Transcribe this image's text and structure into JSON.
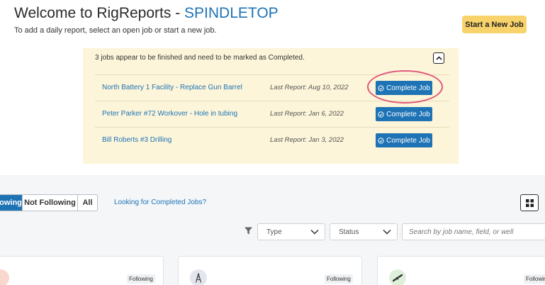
{
  "header": {
    "title_prefix": "Welcome to RigReports - ",
    "company": "SPINDLETOP",
    "subtitle": "To add a daily report, select an open job or start a new job.",
    "start_button": "Start a New Job"
  },
  "notice": {
    "message": "3 jobs appear to be finished and need to be marked as Completed.",
    "rows": [
      {
        "job": "North Battery 1 Facility - Replace Gun Barrel",
        "last_report": "Last Report: Aug 10, 2022",
        "button": "Complete Job"
      },
      {
        "job": "Peter Parker #72 Workover - Hole in tubing",
        "last_report": "Last Report: Jan 6, 2022",
        "button": "Complete Job"
      },
      {
        "job": "Bill Roberts #3 Drilling",
        "last_report": "Last Report: Jan 3, 2022",
        "button": "Complete Job"
      }
    ]
  },
  "filters": {
    "segments": [
      "owing",
      "Not Following",
      "All"
    ],
    "completed_link": "Looking for Completed Jobs?",
    "type_label": "Type",
    "status_label": "Status",
    "search_placeholder": "Search by job name, field, or well"
  },
  "cards": [
    {
      "badge": "Following"
    },
    {
      "badge": "Following"
    },
    {
      "badge": "Followin"
    }
  ],
  "colors": {
    "accent": "#1e73b5",
    "start_button": "#f8d26b",
    "notice_background": "#fdf5d9",
    "highlight_ring": "#e0567a"
  }
}
